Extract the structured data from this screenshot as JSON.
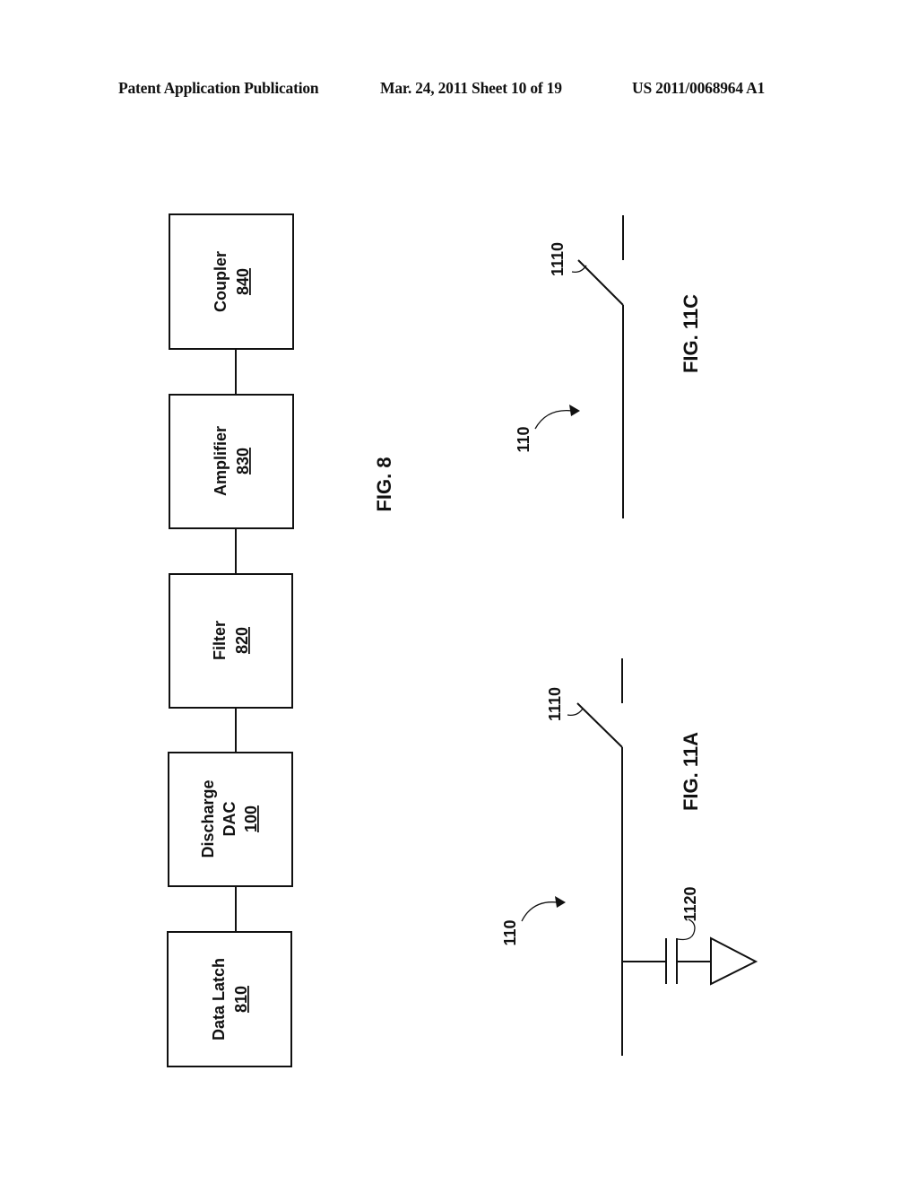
{
  "header": {
    "publication": "Patent Application Publication",
    "date_sheet": "Mar. 24, 2011  Sheet 10 of 19",
    "patent_number": "US 2011/0068964 A1"
  },
  "fig8": {
    "caption": "FIG. 8",
    "blocks": [
      {
        "lines": [
          "Coupler"
        ],
        "ref": "840"
      },
      {
        "lines": [
          "Amplifier"
        ],
        "ref": "830"
      },
      {
        "lines": [
          "Filter"
        ],
        "ref": "820"
      },
      {
        "lines": [
          "Discharge",
          "DAC"
        ],
        "ref": "100"
      },
      {
        "lines": [
          "Data Latch"
        ],
        "ref": "810"
      }
    ]
  },
  "fig11c": {
    "caption": "FIG. 11C",
    "line_ref": "110",
    "switch_ref": "1110"
  },
  "fig11a": {
    "caption": "FIG. 11A",
    "line_ref": "110",
    "switch_ref": "1110",
    "capacitor_ref": "1120"
  }
}
